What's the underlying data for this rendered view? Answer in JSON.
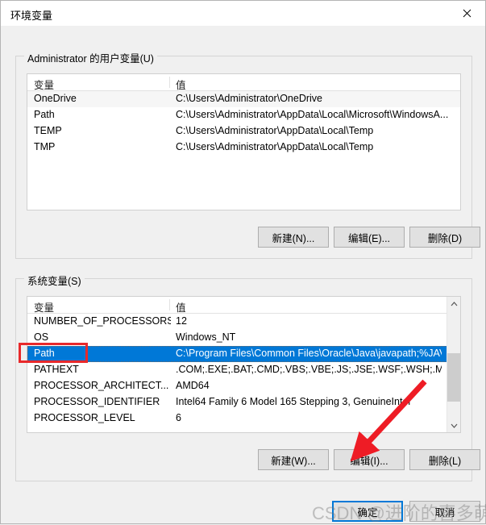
{
  "window": {
    "title": "环境变量",
    "close_icon": "close-icon"
  },
  "user_section": {
    "group_label": "Administrator 的用户变量(U)",
    "columns": [
      "变量",
      "值"
    ],
    "rows": [
      {
        "name": "OneDrive",
        "value": "C:\\Users\\Administrator\\OneDrive"
      },
      {
        "name": "Path",
        "value": "C:\\Users\\Administrator\\AppData\\Local\\Microsoft\\WindowsA..."
      },
      {
        "name": "TEMP",
        "value": "C:\\Users\\Administrator\\AppData\\Local\\Temp"
      },
      {
        "name": "TMP",
        "value": "C:\\Users\\Administrator\\AppData\\Local\\Temp"
      }
    ],
    "buttons": {
      "new": "新建(N)...",
      "edit": "编辑(E)...",
      "delete": "删除(D)"
    }
  },
  "system_section": {
    "group_label": "系统变量(S)",
    "columns": [
      "变量",
      "值"
    ],
    "rows": [
      {
        "name": "NUMBER_OF_PROCESSORS",
        "value": "12"
      },
      {
        "name": "OS",
        "value": "Windows_NT"
      },
      {
        "name": "Path",
        "value": "C:\\Program Files\\Common Files\\Oracle\\Java\\javapath;%JAVA..."
      },
      {
        "name": "PATHEXT",
        "value": ".COM;.EXE;.BAT;.CMD;.VBS;.VBE;.JS;.JSE;.WSF;.WSH;.MSC"
      },
      {
        "name": "PROCESSOR_ARCHITECT...",
        "value": "AMD64"
      },
      {
        "name": "PROCESSOR_IDENTIFIER",
        "value": "Intel64 Family 6 Model 165 Stepping 3, GenuineIntel"
      },
      {
        "name": "PROCESSOR_LEVEL",
        "value": "6"
      }
    ],
    "selected_row_index": 2,
    "buttons": {
      "new": "新建(W)...",
      "edit": "编辑(I)...",
      "delete": "删除(L)"
    },
    "scrollbar": {
      "up_arrow": "chevron-up-icon",
      "down_arrow": "chevron-down-icon"
    }
  },
  "dialog_buttons": {
    "ok": "确定",
    "cancel": "取消"
  },
  "annotations": {
    "highlight_color": "#e8292b",
    "arrow_color": "#ee1c25",
    "watermark": "CSDN @进阶的喜多萌~"
  }
}
